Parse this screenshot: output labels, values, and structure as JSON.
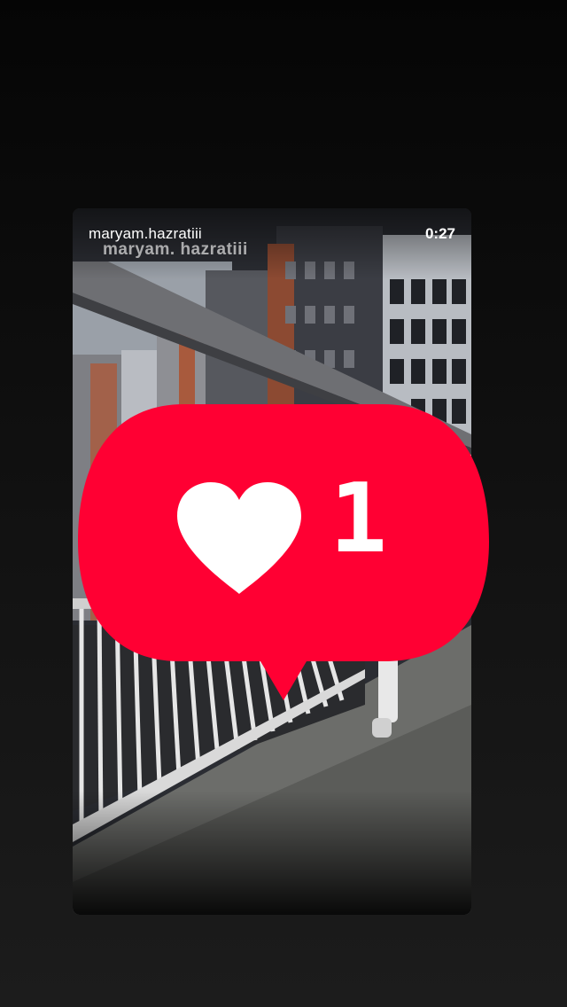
{
  "story": {
    "username": "maryam.hazratiii",
    "watermark": "maryam. hazratiii",
    "timer": "0:27"
  },
  "like_notification": {
    "icon": "heart-icon",
    "count": "1"
  },
  "colors": {
    "background": "#111111",
    "like_bubble": "#ff0033",
    "text": "#ffffff"
  }
}
